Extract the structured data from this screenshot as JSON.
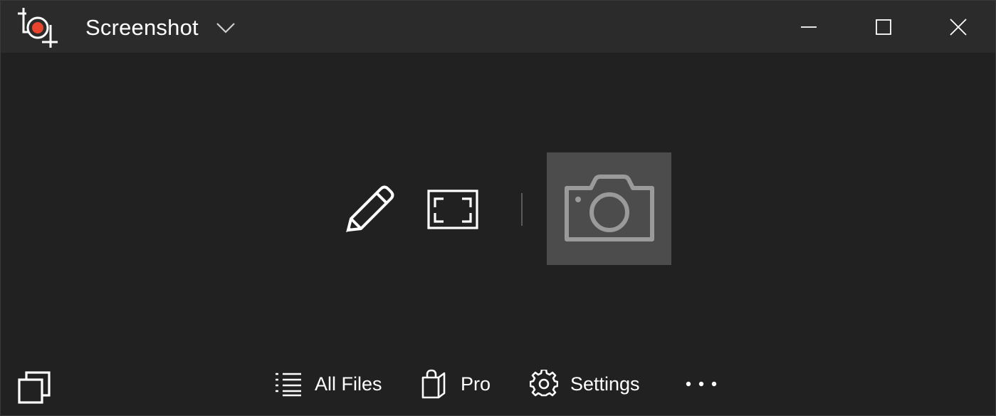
{
  "titlebar": {
    "app_icon": "screenshot-app-icon",
    "title": "Screenshot",
    "dropdown_icon": "chevron-down-icon",
    "minimize_icon": "minimize-icon",
    "maximize_icon": "maximize-icon",
    "close_icon": "close-icon"
  },
  "toolbar": {
    "tools": [
      {
        "icon": "pencil-icon"
      },
      {
        "icon": "fullscreen-frame-icon"
      }
    ],
    "capture_icon": "camera-icon"
  },
  "footer": {
    "left_icon": "overlapping-windows-icon",
    "items": [
      {
        "label": "All Files",
        "icon": "list-icon"
      },
      {
        "label": "Pro",
        "icon": "shopping-bag-icon"
      },
      {
        "label": "Settings",
        "icon": "gear-icon"
      },
      {
        "label": "",
        "icon": "more-icon"
      }
    ]
  },
  "colors": {
    "background": "#212121",
    "titlebar": "#2b2b2b",
    "capture_button": "#4c4c4c",
    "accent_record": "#e8442e"
  }
}
